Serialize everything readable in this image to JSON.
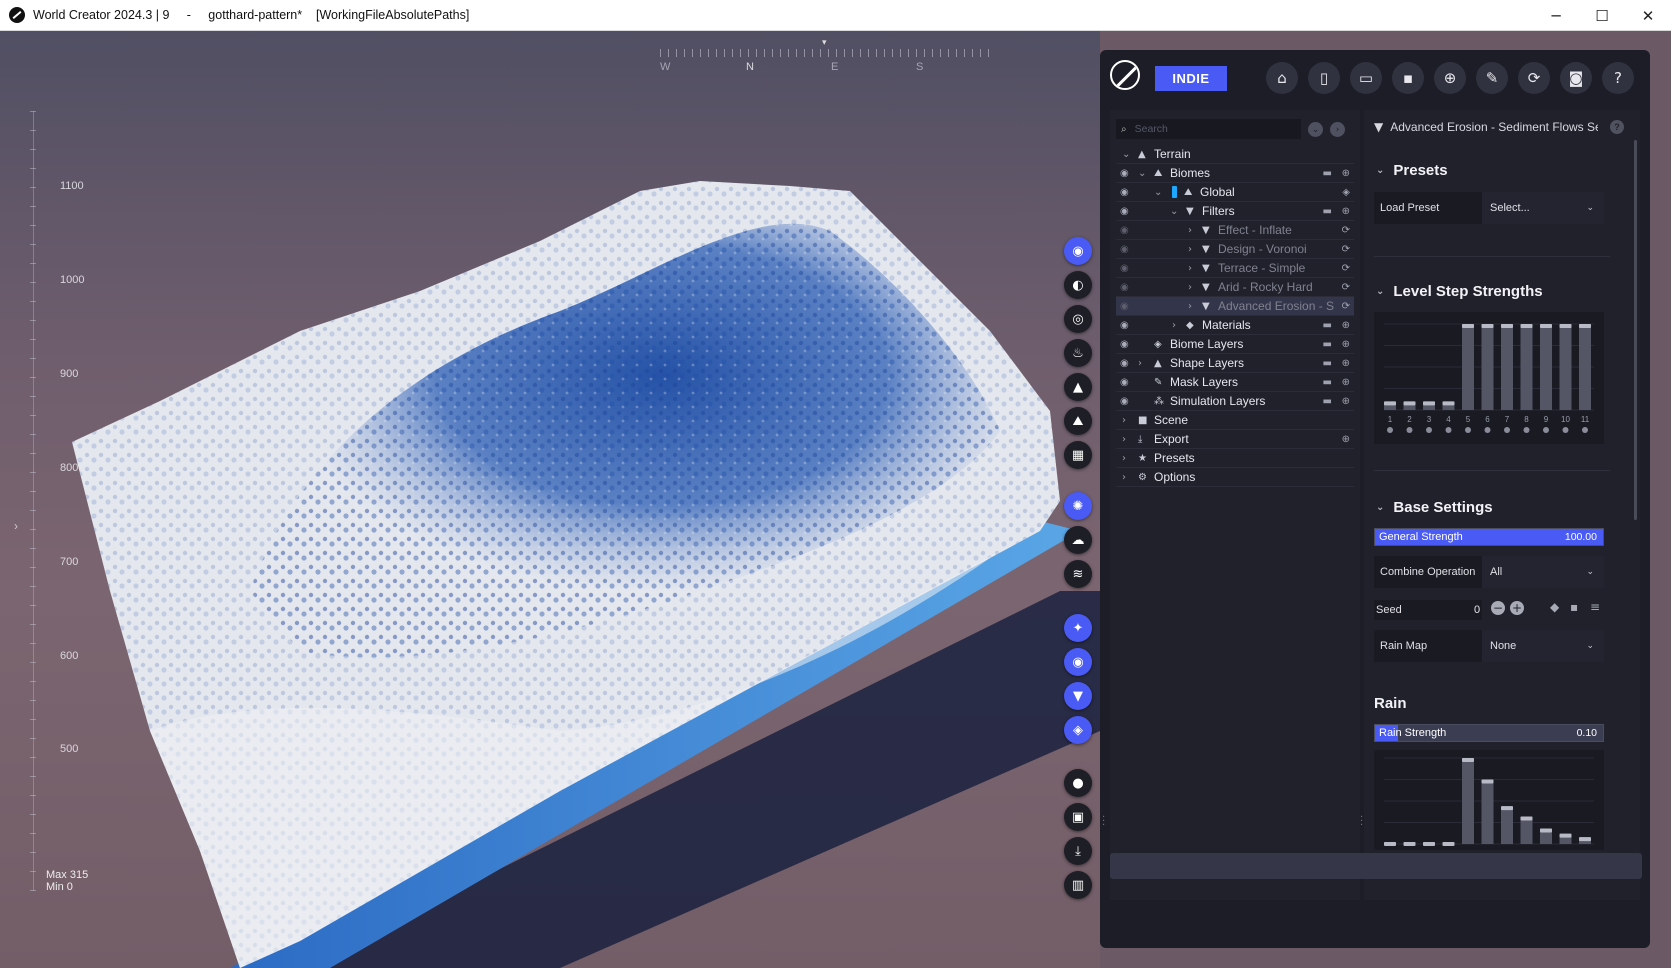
{
  "window": {
    "title": "World Creator 2024.3 | 9     -     gotthard-pattern*    [WorkingFileAbsolutePaths]",
    "minimize": "─",
    "maximize": "☐",
    "close": "✕"
  },
  "viewport": {
    "compass": [
      "W",
      "N",
      "E",
      "S"
    ],
    "altitude_labels": [
      "1100",
      "1000",
      "900",
      "800",
      "700",
      "600",
      "500"
    ],
    "max_label": "Max 315",
    "min_label": "Min 0"
  },
  "toolbar": {
    "edition_label": "INDIE",
    "icons": [
      "home-icon",
      "new-file-icon",
      "open-folder-icon",
      "save-icon",
      "save-as-icon",
      "export-icon",
      "refresh-icon",
      "camera-icon",
      "help-icon"
    ]
  },
  "tree": {
    "search_placeholder": "Search",
    "items": [
      {
        "label": "Terrain"
      },
      {
        "label": "Biomes"
      },
      {
        "label": "Global"
      },
      {
        "label": "Filters"
      },
      {
        "label": "Effect - Inflate"
      },
      {
        "label": "Design - Voronoi"
      },
      {
        "label": "Terrace - Simple"
      },
      {
        "label": "Arid - Rocky Hard"
      },
      {
        "label": "Advanced Erosion - Sediment Flows"
      },
      {
        "label": "Materials"
      },
      {
        "label": "Biome Layers"
      },
      {
        "label": "Shape Layers"
      },
      {
        "label": "Mask Layers"
      },
      {
        "label": "Simulation Layers"
      },
      {
        "label": "Scene"
      },
      {
        "label": "Export"
      },
      {
        "label": "Presets"
      },
      {
        "label": "Options"
      }
    ]
  },
  "settings": {
    "header": "Advanced Erosion - Sediment Flows Settings",
    "presets": {
      "title": "Presets",
      "load_label": "Load Preset",
      "load_value": "Select..."
    },
    "level_steps": {
      "title": "Level Step Strengths",
      "labels": [
        "1",
        "2",
        "3",
        "4",
        "5",
        "6",
        "7",
        "8",
        "9",
        "10",
        "11"
      ],
      "values": [
        0.1,
        0.1,
        0.1,
        0.1,
        1.0,
        1.0,
        1.0,
        1.0,
        1.0,
        1.0,
        1.0
      ]
    },
    "base": {
      "title": "Base Settings",
      "general_strength_label": "General Strength",
      "general_strength_value": "100.00",
      "general_strength_fraction": 1.0,
      "combine_label": "Combine Operation",
      "combine_value": "All",
      "seed_label": "Seed",
      "seed_value": "0",
      "rain_map_label": "Rain Map",
      "rain_map_value": "None"
    },
    "rain": {
      "title": "Rain",
      "strength_label": "Rain Strength",
      "strength_value": "0.10",
      "strength_fraction": 0.1,
      "values": [
        0.0,
        0.0,
        0.0,
        0.0,
        1.0,
        0.75,
        0.44,
        0.32,
        0.18,
        0.12,
        0.08
      ]
    }
  },
  "colors": {
    "accent": "#4a5af5",
    "panel": "#1c1d26",
    "biome_global": "#1ea7ff"
  }
}
